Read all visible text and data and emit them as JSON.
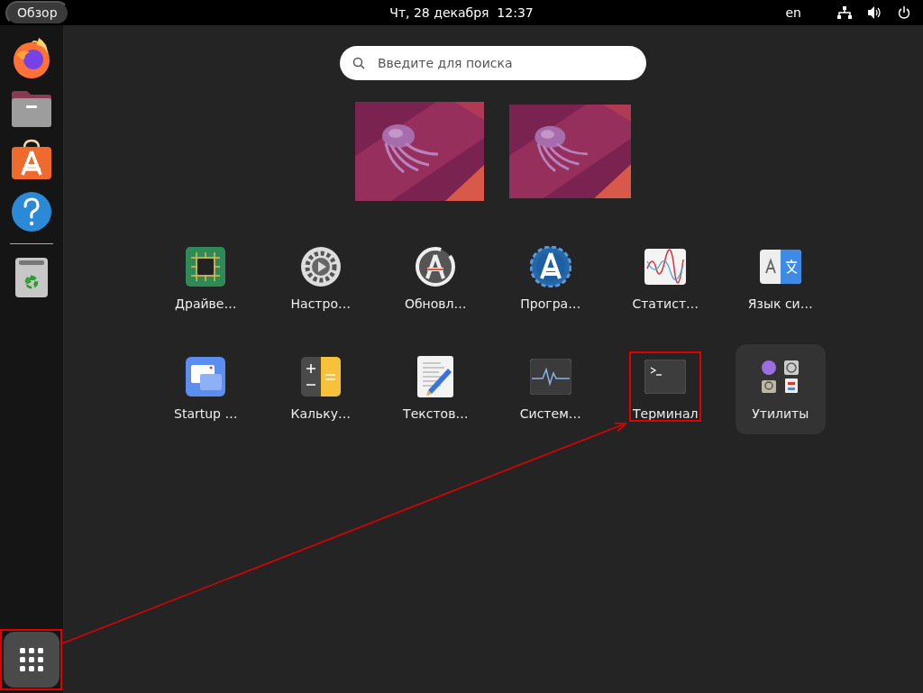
{
  "top_bar": {
    "activities": "Обзор",
    "clock": "Чт, 28 декабря  12:37",
    "keyboard_layout": "en"
  },
  "dock": {
    "items": [
      {
        "kind": "browser"
      },
      {
        "kind": "files"
      },
      {
        "kind": "store"
      },
      {
        "kind": "help"
      },
      {
        "kind": "trash"
      }
    ],
    "show_apps": {
      "highlighted": true
    }
  },
  "search": {
    "placeholder": "Введите для поиска"
  },
  "apps": [
    {
      "label": "Драйве…",
      "kind": "chip",
      "highlighted": false
    },
    {
      "label": "Настро…",
      "kind": "gear",
      "highlighted": false
    },
    {
      "label": "Обновл…",
      "kind": "updater",
      "highlighted": false
    },
    {
      "label": "Програ…",
      "kind": "software",
      "highlighted": false
    },
    {
      "label": "Статист…",
      "kind": "stats",
      "highlighted": false
    },
    {
      "label": "Язык си…",
      "kind": "language",
      "highlighted": false
    },
    {
      "label": "Startup …",
      "kind": "startup",
      "highlighted": false
    },
    {
      "label": "Кальку…",
      "kind": "calculator",
      "highlighted": false
    },
    {
      "label": "Текстов…",
      "kind": "editor",
      "highlighted": false
    },
    {
      "label": "Систем…",
      "kind": "monitor",
      "highlighted": false
    },
    {
      "label": "Терминал",
      "kind": "terminal",
      "highlighted": true
    },
    {
      "label": "Утилиты",
      "kind": "folder",
      "highlighted": false
    }
  ],
  "annotation": {
    "arrow": true
  }
}
